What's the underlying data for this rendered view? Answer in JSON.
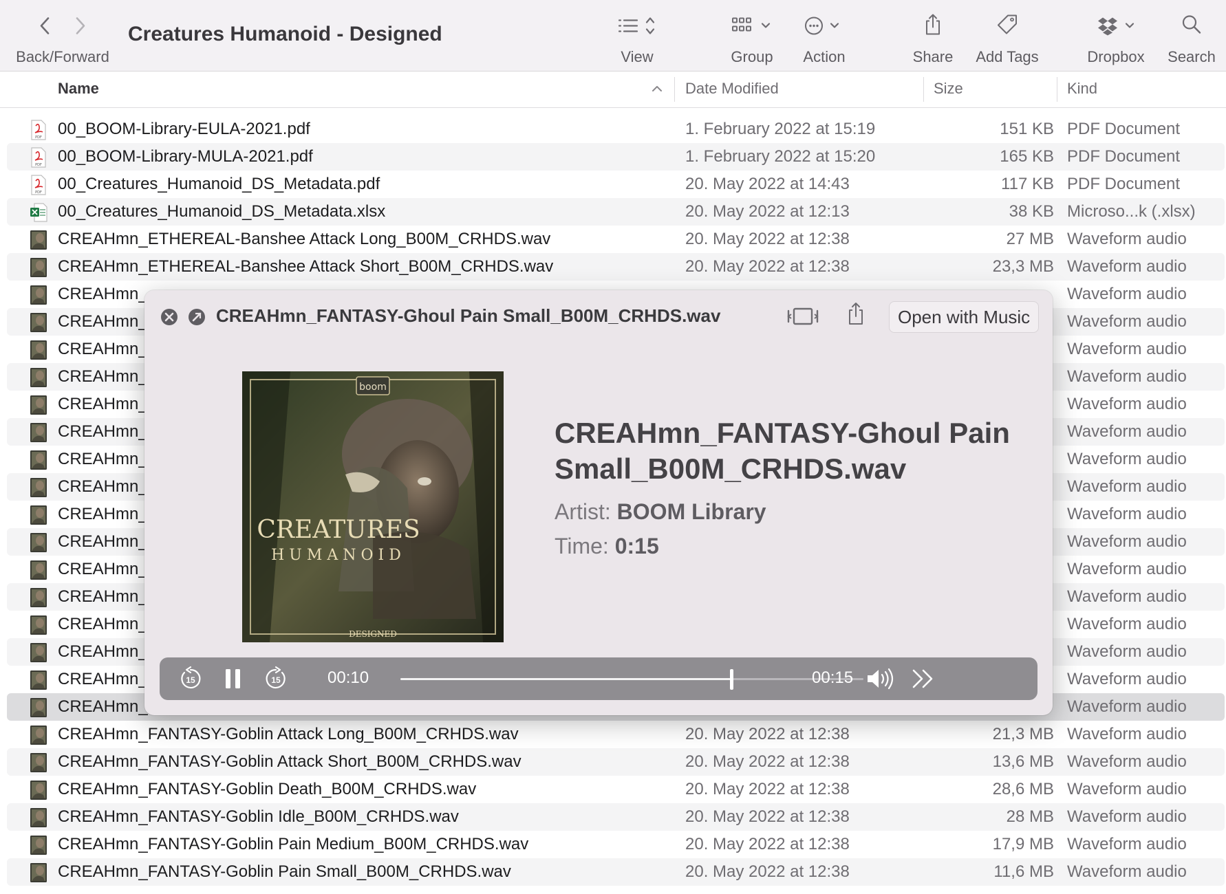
{
  "window": {
    "title": "Creatures Humanoid - Designed"
  },
  "toolbar": {
    "back_forward_label": "Back/Forward",
    "view_label": "View",
    "group_label": "Group",
    "action_label": "Action",
    "share_label": "Share",
    "add_tags_label": "Add Tags",
    "dropbox_label": "Dropbox",
    "search_label": "Search"
  },
  "columns": {
    "name": "Name",
    "date": "Date Modified",
    "size": "Size",
    "kind": "Kind"
  },
  "files": [
    {
      "name": "00_BOOM-Library-EULA-2021.pdf",
      "date": "1. February 2022 at 15:19",
      "size": "151 KB",
      "kind": "PDF Document",
      "icon": "pdf-icon"
    },
    {
      "name": "00_BOOM-Library-MULA-2021.pdf",
      "date": "1. February 2022 at 15:20",
      "size": "165 KB",
      "kind": "PDF Document",
      "icon": "pdf-icon"
    },
    {
      "name": "00_Creatures_Humanoid_DS_Metadata.pdf",
      "date": "20. May 2022 at 14:43",
      "size": "117 KB",
      "kind": "PDF Document",
      "icon": "pdf-icon"
    },
    {
      "name": "00_Creatures_Humanoid_DS_Metadata.xlsx",
      "date": "20. May 2022 at 12:13",
      "size": "38 KB",
      "kind": "Microso...k (.xlsx)",
      "icon": "excel-icon"
    },
    {
      "name": "CREAHmn_ETHEREAL-Banshee Attack Long_B00M_CRHDS.wav",
      "date": "20. May 2022 at 12:38",
      "size": "27 MB",
      "kind": "Waveform audio",
      "icon": "audio-file-icon"
    },
    {
      "name": "CREAHmn_ETHEREAL-Banshee Attack Short_B00M_CRHDS.wav",
      "date": "20. May 2022 at 12:38",
      "size": "23,3 MB",
      "kind": "Waveform audio",
      "icon": "audio-file-icon"
    },
    {
      "name": "CREAHmn_",
      "date": "",
      "size": "",
      "kind": "Waveform audio",
      "icon": "audio-file-icon"
    },
    {
      "name": "CREAHmn_",
      "date": "",
      "size": "",
      "kind": "Waveform audio",
      "icon": "audio-file-icon"
    },
    {
      "name": "CREAHmn_",
      "date": "",
      "size": "",
      "kind": "Waveform audio",
      "icon": "audio-file-icon"
    },
    {
      "name": "CREAHmn_",
      "date": "",
      "size": "",
      "kind": "Waveform audio",
      "icon": "audio-file-icon"
    },
    {
      "name": "CREAHmn_",
      "date": "",
      "size": "",
      "kind": "Waveform audio",
      "icon": "audio-file-icon"
    },
    {
      "name": "CREAHmn_",
      "date": "",
      "size": "",
      "kind": "Waveform audio",
      "icon": "audio-file-icon"
    },
    {
      "name": "CREAHmn_",
      "date": "",
      "size": "",
      "kind": "Waveform audio",
      "icon": "audio-file-icon"
    },
    {
      "name": "CREAHmn_",
      "date": "",
      "size": "",
      "kind": "Waveform audio",
      "icon": "audio-file-icon"
    },
    {
      "name": "CREAHmn_",
      "date": "",
      "size": "",
      "kind": "Waveform audio",
      "icon": "audio-file-icon"
    },
    {
      "name": "CREAHmn_",
      "date": "",
      "size": "",
      "kind": "Waveform audio",
      "icon": "audio-file-icon"
    },
    {
      "name": "CREAHmn_",
      "date": "",
      "size": "",
      "kind": "Waveform audio",
      "icon": "audio-file-icon"
    },
    {
      "name": "CREAHmn_",
      "date": "",
      "size": "",
      "kind": "Waveform audio",
      "icon": "audio-file-icon"
    },
    {
      "name": "CREAHmn_",
      "date": "",
      "size": "",
      "kind": "Waveform audio",
      "icon": "audio-file-icon"
    },
    {
      "name": "CREAHmn_",
      "date": "",
      "size": "",
      "kind": "Waveform audio",
      "icon": "audio-file-icon"
    },
    {
      "name": "CREAHmn_",
      "date": "",
      "size": "",
      "kind": "Waveform audio",
      "icon": "audio-file-icon"
    },
    {
      "name": "CREAHmn_",
      "date": "",
      "size": "",
      "kind": "Waveform audio",
      "icon": "audio-file-icon",
      "selected": true
    },
    {
      "name": "CREAHmn_FANTASY-Goblin Attack Long_B00M_CRHDS.wav",
      "date": "20. May 2022 at 12:38",
      "size": "21,3 MB",
      "kind": "Waveform audio",
      "icon": "audio-file-icon"
    },
    {
      "name": "CREAHmn_FANTASY-Goblin Attack Short_B00M_CRHDS.wav",
      "date": "20. May 2022 at 12:38",
      "size": "13,6 MB",
      "kind": "Waveform audio",
      "icon": "audio-file-icon"
    },
    {
      "name": "CREAHmn_FANTASY-Goblin Death_B00M_CRHDS.wav",
      "date": "20. May 2022 at 12:38",
      "size": "28,6 MB",
      "kind": "Waveform audio",
      "icon": "audio-file-icon"
    },
    {
      "name": "CREAHmn_FANTASY-Goblin Idle_B00M_CRHDS.wav",
      "date": "20. May 2022 at 12:38",
      "size": "28 MB",
      "kind": "Waveform audio",
      "icon": "audio-file-icon"
    },
    {
      "name": "CREAHmn_FANTASY-Goblin Pain Medium_B00M_CRHDS.wav",
      "date": "20. May 2022 at 12:38",
      "size": "17,9 MB",
      "kind": "Waveform audio",
      "icon": "audio-file-icon"
    },
    {
      "name": "CREAHmn_FANTASY-Goblin Pain Small_B00M_CRHDS.wav",
      "date": "20. May 2022 at 12:38",
      "size": "11,6 MB",
      "kind": "Waveform audio",
      "icon": "audio-file-icon"
    }
  ],
  "quicklook": {
    "filename": "CREAHmn_FANTASY-Ghoul Pain Small_B00M_CRHDS.wav",
    "open_with_label": "Open with Music",
    "track_title": "CREAHmn_FANTASY-Ghoul Pain Small_B00M_CRHDS.wav",
    "artist_label": "Artist:",
    "artist": "BOOM Library",
    "time_label": "Time:",
    "time": "0:15",
    "elapsed": "00:10",
    "duration": "00:15",
    "progress": 0.715,
    "skip_back_seconds": "15",
    "skip_forward_seconds": "15",
    "album_art": {
      "brand": "boom",
      "title": "CREATURES",
      "subtitle": "HUMANOID",
      "edition": "DESIGNED"
    }
  }
}
